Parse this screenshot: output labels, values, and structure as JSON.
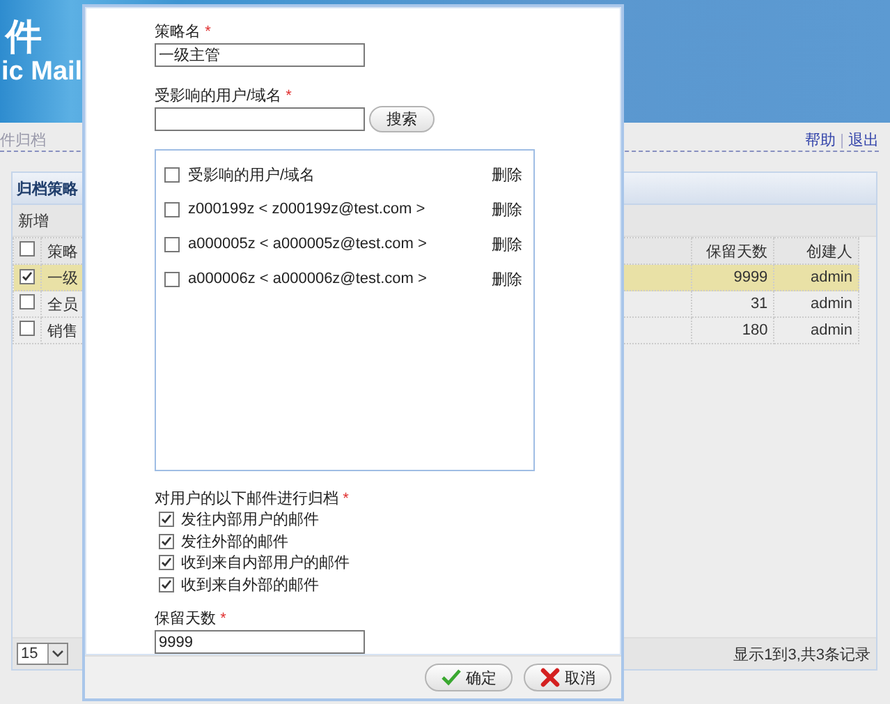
{
  "header": {
    "logo_fragments": [
      "件",
      "ic Mail"
    ]
  },
  "breadcrumb": "件归档",
  "top_links": [
    {
      "label": "帮助"
    },
    {
      "label": "退出"
    }
  ],
  "top_links_separator": "|",
  "panel": {
    "title": "归档策略",
    "toolbar": [
      "新增"
    ],
    "all_checked": false,
    "columns": [
      {
        "label": "策略"
      },
      {
        "label": "保留天数"
      },
      {
        "label": "创建人"
      }
    ],
    "rows": [
      {
        "name": "一级",
        "days": "9999",
        "creator": "admin",
        "selected": true
      },
      {
        "name": "全员",
        "days": "31",
        "creator": "admin",
        "selected": false
      },
      {
        "name": "销售",
        "days": "180",
        "creator": "admin",
        "selected": false
      }
    ],
    "page_size": "15",
    "summary": "显示1到3,共3条记录"
  },
  "dialog": {
    "name_field": {
      "label": "策略名",
      "mark": "*",
      "value": "一级主管"
    },
    "users_field": {
      "label": "受影响的用户/域名",
      "mark": "*",
      "button": "搜索"
    },
    "user_list": [
      {
        "label": "受影响的用户/域名",
        "checked": false,
        "action": "删除"
      },
      {
        "label": "z000199z < z000199z@test.com >",
        "checked": false,
        "action": "删除"
      },
      {
        "label": "a000005z < a000005z@test.com >",
        "checked": false,
        "action": "删除"
      },
      {
        "label": "a000006z < a000006z@test.com >",
        "checked": false,
        "action": "删除"
      }
    ],
    "mail_types": {
      "label": "对用户的以下邮件进行归档",
      "mark": "*",
      "options": [
        {
          "label": "发往内部用户的邮件",
          "checked": true
        },
        {
          "label": "发往外部的邮件",
          "checked": true
        },
        {
          "label": "收到来自内部用户的邮件",
          "checked": true
        },
        {
          "label": "收到来自外部的邮件",
          "checked": true
        }
      ]
    },
    "retention_field": {
      "label": "保留天数",
      "mark": "*",
      "value": "9999"
    },
    "buttons": [
      {
        "label": "确定",
        "kind": "ok"
      },
      {
        "label": "取消",
        "kind": "cancel"
      }
    ]
  }
}
